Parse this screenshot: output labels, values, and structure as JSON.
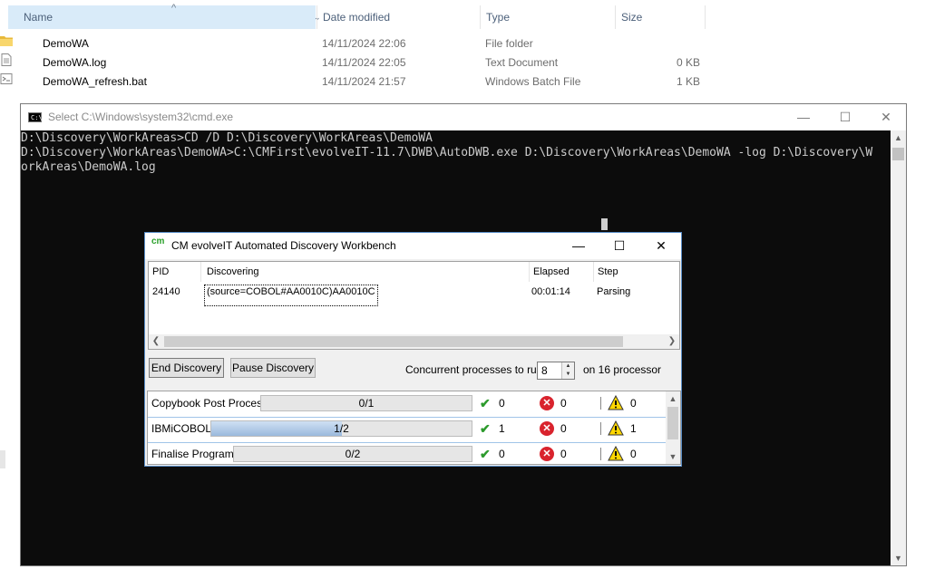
{
  "explorer": {
    "columns": {
      "name": "Name",
      "date": "Date modified",
      "type": "Type",
      "size": "Size"
    },
    "files": [
      {
        "name": "DemoWA",
        "date": "14/11/2024 22:06",
        "type": "File folder",
        "size": "",
        "icon": "folder-icon"
      },
      {
        "name": "DemoWA.log",
        "date": "14/11/2024 22:05",
        "type": "Text Document",
        "size": "0 KB",
        "icon": "text-file-icon"
      },
      {
        "name": "DemoWA_refresh.bat",
        "date": "14/11/2024 21:57",
        "type": "Windows Batch File",
        "size": "1 KB",
        "icon": "batch-file-icon"
      }
    ]
  },
  "cmd": {
    "title": "Select C:\\Windows\\system32\\cmd.exe",
    "lines": [
      "",
      "D:\\Discovery\\WorkAreas>CD /D D:\\Discovery\\WorkAreas\\DemoWA",
      "",
      "D:\\Discovery\\WorkAreas\\DemoWA>C:\\CMFirst\\evolveIT-11.7\\DWB\\AutoDWB.exe D:\\Discovery\\WorkAreas\\DemoWA -log D:\\Discovery\\W",
      "orkAreas\\DemoWA.log"
    ]
  },
  "workbench": {
    "logo_text": "cm",
    "title": "CM evolveIT Automated Discovery Workbench",
    "grid": {
      "headers": {
        "pid": "PID",
        "discovering": "Discovering",
        "elapsed": "Elapsed",
        "step": "Step"
      },
      "rows": [
        {
          "pid": "24140",
          "discovering": "(source=COBOL#AA0010C)AA0010C",
          "elapsed": "00:01:14",
          "step": "Parsing"
        }
      ]
    },
    "buttons": {
      "end": "End Discovery",
      "pause": "Pause Discovery"
    },
    "concurrent": {
      "label": "Concurrent processes to run:",
      "value": "8",
      "suffix": "on 16 processor"
    },
    "processes": [
      {
        "name": "Copybook Post Process",
        "progress_text": "0/1",
        "progress": 0.0,
        "ok": "0",
        "errors": "0",
        "warnings": "0"
      },
      {
        "name": "IBMiCOBOL",
        "progress_text": "1/2",
        "progress": 0.5,
        "ok": "1",
        "errors": "0",
        "warnings": "1"
      },
      {
        "name": "Finalise Programs",
        "progress_text": "0/2",
        "progress": 0.0,
        "ok": "0",
        "errors": "0",
        "warnings": "0"
      }
    ],
    "status_colors": {
      "ok": "#2c9a2c",
      "error": "#d9232d",
      "warning": "#ffd700"
    }
  }
}
